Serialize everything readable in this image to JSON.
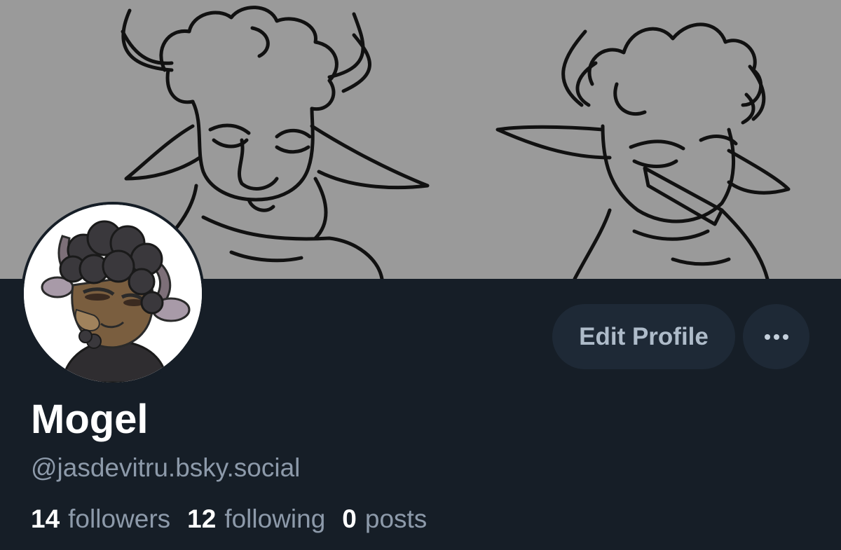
{
  "banner": {
    "background_color": "#9a9a9a",
    "art": "sketch of two horned goat characters"
  },
  "avatar": {
    "art": "sheep character with dark curly wool"
  },
  "actions": {
    "edit_profile_label": "Edit Profile",
    "more_icon": "ellipsis-icon"
  },
  "profile": {
    "display_name": "Mogel",
    "handle": "@jasdevitru.bsky.social"
  },
  "stats": {
    "followers_count": "14",
    "followers_label": "followers",
    "following_count": "12",
    "following_label": "following",
    "posts_count": "0",
    "posts_label": "posts"
  },
  "colors": {
    "page_bg": "#161e27",
    "button_bg": "#1e2936",
    "muted_text": "#8d9aaa",
    "primary_text": "#ffffff"
  }
}
